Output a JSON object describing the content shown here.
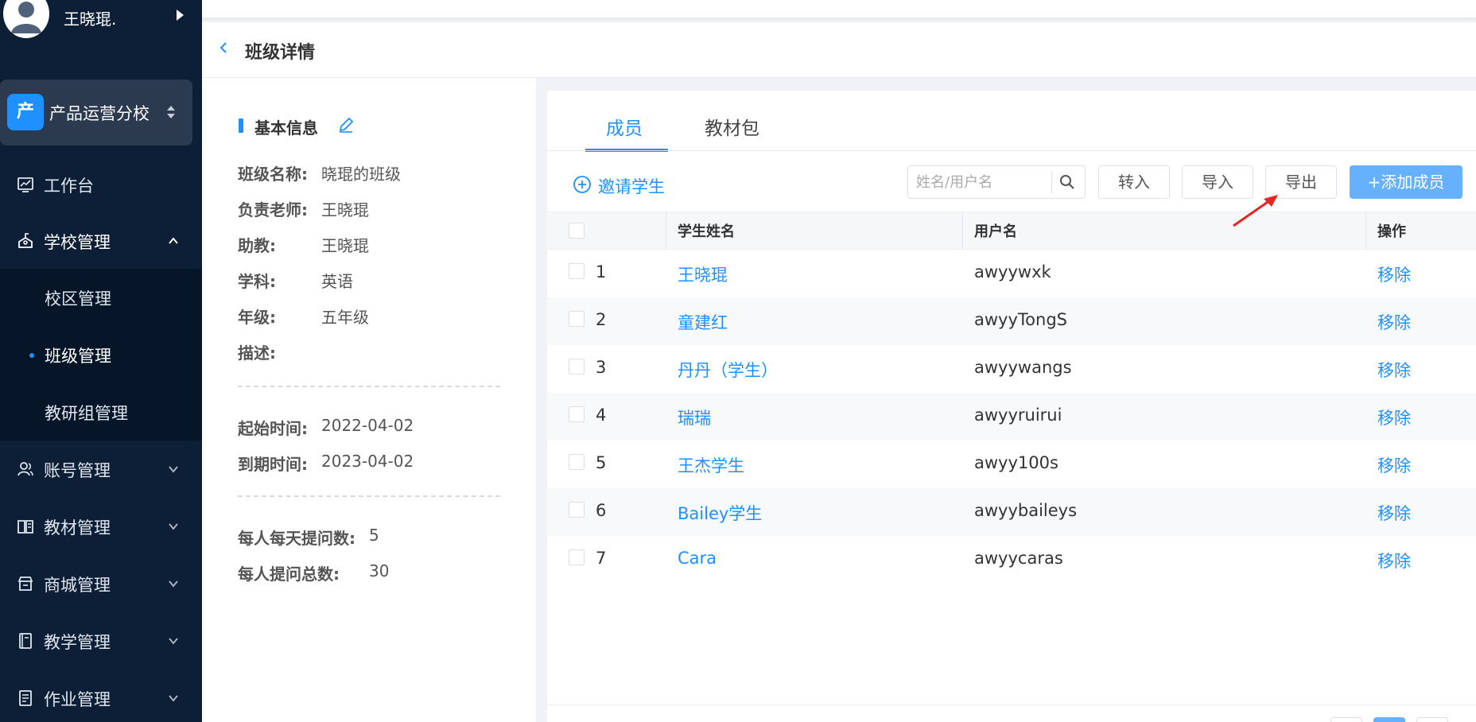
{
  "user": {
    "name": "王晓琨."
  },
  "school": {
    "logo": "产",
    "name": "产品运营分校"
  },
  "nav": {
    "workbench": "工作台",
    "school_mgmt": "学校管理",
    "campus_mgmt": "校区管理",
    "class_mgmt": "班级管理",
    "research_mgmt": "教研组管理",
    "account_mgmt": "账号管理",
    "textbook_mgmt": "教材管理",
    "mall_mgmt": "商城管理",
    "teaching_mgmt": "教学管理",
    "homework_mgmt": "作业管理"
  },
  "header": {
    "title": "班级详情"
  },
  "info": {
    "section_title": "基本信息",
    "fields": [
      {
        "label": "班级名称:",
        "value": "晓琨的班级"
      },
      {
        "label": "负责老师:",
        "value": "王晓琨"
      },
      {
        "label": "助教:",
        "value": "王晓琨"
      },
      {
        "label": "学科:",
        "value": "英语"
      },
      {
        "label": "年级:",
        "value": "五年级"
      },
      {
        "label": "描述:",
        "value": ""
      }
    ],
    "start_label": "起始时间:",
    "start_value": "2022-04-02",
    "end_label": "到期时间:",
    "end_value": "2023-04-02",
    "daily_q_label": "每人每天提问数:",
    "daily_q_value": "5",
    "total_q_label": "每人提问总数:",
    "total_q_value": "30"
  },
  "tabs": {
    "members": "成员",
    "materials": "教材包"
  },
  "toolbar": {
    "invite": "邀请学生",
    "search_placeholder": "姓名/用户名",
    "transfer": "转入",
    "import": "导入",
    "export": "导出",
    "add": "添加成员"
  },
  "table": {
    "headers": {
      "name": "学生姓名",
      "username": "用户名",
      "action": "操作"
    },
    "rows": [
      {
        "idx": "1",
        "name": "王晓琨",
        "username": "awyywxk",
        "action": "移除"
      },
      {
        "idx": "2",
        "name": "童建红",
        "username": "awyyTongS",
        "action": "移除"
      },
      {
        "idx": "3",
        "name": "丹丹（学生）",
        "username": "awyywangs",
        "action": "移除"
      },
      {
        "idx": "4",
        "name": "瑞瑞",
        "username": "awyyruirui",
        "action": "移除"
      },
      {
        "idx": "5",
        "name": "王杰学生",
        "username": "awyy100s",
        "action": "移除"
      },
      {
        "idx": "6",
        "name": "Bailey学生",
        "username": "awyybaileys",
        "action": "移除"
      },
      {
        "idx": "7",
        "name": "Cara",
        "username": "awyycaras",
        "action": "移除"
      }
    ]
  },
  "colors": {
    "accent": "#1e90ff",
    "sidebar_bg": "#0c1f36",
    "primary_btn": "#66b1ff",
    "annotation": "#e8261f"
  }
}
